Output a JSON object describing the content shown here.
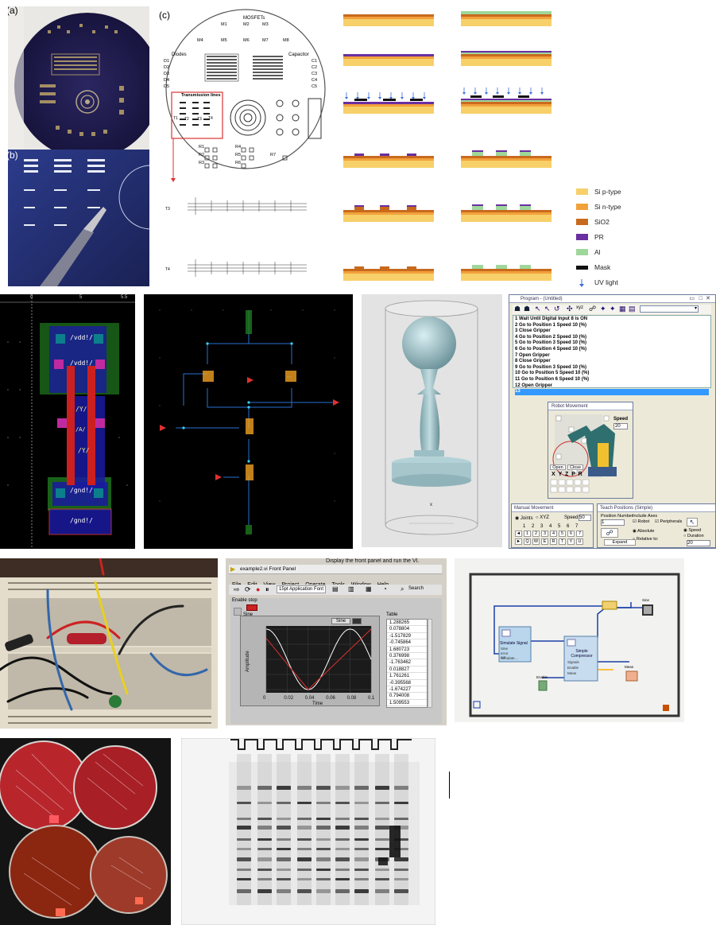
{
  "panels": {
    "a": {
      "label": "(a)"
    },
    "b": {
      "label": "(b)"
    },
    "c": {
      "label": "(c)",
      "mosfets_title": "MOSFETs",
      "mosfets": [
        "M1",
        "M2",
        "M3",
        "M4",
        "M5",
        "M6",
        "M7",
        "M8"
      ],
      "diodes_title": "Diodes",
      "diodes": [
        "D1",
        "D2",
        "D3",
        "D4",
        "D5"
      ],
      "capacitor_title": "Capacitor",
      "capacitors": [
        "C1",
        "C2",
        "C3",
        "C4",
        "C5"
      ],
      "tlines_title": "Transmission lines",
      "tlines": [
        "T1",
        "T2",
        "T3",
        "T4"
      ],
      "resistors": [
        "R1",
        "R2",
        "R3",
        "R4",
        "R5",
        "R6",
        "R7"
      ],
      "t3_label": "T3",
      "t4_label": "T4",
      "legend": [
        {
          "label": "Si p-type",
          "color": "#f7d06a"
        },
        {
          "label": "Si n-type",
          "color": "#f2a13a"
        },
        {
          "label": "SiO2",
          "color": "#c86a1e"
        },
        {
          "label": "PR",
          "color": "#6a2fa0"
        },
        {
          "label": "Al",
          "color": "#9fd79a"
        },
        {
          "label": "Mask",
          "color": "#111111"
        },
        {
          "label": "UV light",
          "color": "#3a6fd8"
        }
      ]
    },
    "layout": {
      "labels": [
        "/vdd!/",
        "/vdd!/",
        "/Y/",
        "/Y/",
        "/A/",
        "/gnd!/",
        "/gnd!/"
      ],
      "ruler": [
        "0",
        "5",
        "5.5"
      ]
    },
    "program": {
      "title": "Program - (Untitled)",
      "lines": [
        "1  Wait Until Digital Input 8 is ON",
        "2  Go to Position 1 Speed 10 (%)",
        "3  Close Gripper",
        "4  Go to Position 2 Speed 10 (%)",
        "5  Go to Position 3 Speed 10 (%)",
        "6  Go to Position 4 Speed 10 (%)",
        "7  Open Gripper",
        "8  Close Gripper",
        "9  Go to Position 3 Speed 10 (%)",
        "10  Go to Position 5 Speed 10 (%)",
        "11  Go to Position 6 Speed 10 (%)",
        "12  Open Gripper",
        "13"
      ],
      "robot_title": "Robot Movement",
      "speed_label": "Speed",
      "speed_value": "20",
      "open_label": "Open",
      "close_label": "Close",
      "axes": "X Y Z P R",
      "manual_title": "Manual Movement",
      "joints_label": "Joints",
      "xyz_label": "XYZ",
      "manual_speed_label": "Speed:",
      "manual_speed_value": "50",
      "joint_numbers": [
        "1",
        "2",
        "3",
        "4",
        "5",
        "6",
        "7"
      ],
      "keys": [
        "Q",
        "W",
        "E",
        "R",
        "T",
        "Y",
        "U"
      ],
      "teach_title": "Teach Positions (Simple)",
      "position_number_label": "Position Number",
      "position_number_value": "1",
      "include_axes_label": "Include Axes",
      "robot_label": "Robot",
      "peripherals_label": "Peripherals",
      "absolute_label": "Absolute",
      "relative_label": "Relative to:",
      "expand_label": "Expand",
      "speed_opt": "Speed",
      "duration_opt": "Duration",
      "teach_speed_value": "20"
    },
    "labview": {
      "caption": "Display the front panel and run the VI.",
      "title": "example2.vi Front Panel",
      "menu": [
        "File",
        "Edit",
        "View",
        "Project",
        "Operate",
        "Tools",
        "Window",
        "Help"
      ],
      "font_select": "15pt Application Font",
      "search": "Search",
      "enable_stop": "Enable stop",
      "sine_label": "Sine",
      "sine_plot_label": "Sine",
      "ylabel": "Amplitude",
      "xlabel": "Time",
      "table_title": "Table",
      "table_values": [
        "1.288265",
        "0.078804",
        "-1.517829",
        "-0.745864",
        "1.680723",
        "0.376998",
        "-1.763462",
        "0.018827",
        "1.761261",
        "-0.395568",
        "-1.674227",
        "0.794008",
        "1.509553"
      ],
      "xticks": [
        "0",
        "0.02",
        "0.04",
        "0.06",
        "0.08",
        "0.1"
      ]
    },
    "blockdiagram": {
      "simulate_label": "Simulate Signal",
      "simulate_items": [
        "Sine",
        "error out",
        "Simulate..."
      ],
      "compress_label": "Simple Compressor",
      "compress_items": [
        "Signals",
        "Enable",
        "Mean"
      ],
      "enable_label": "Enable",
      "sine_label": "Sine",
      "mean_label": "Mean"
    }
  },
  "chart_data": {
    "type": "line",
    "title": "",
    "xlabel": "Time",
    "ylabel": "Amplitude",
    "xlim": [
      0,
      0.1
    ],
    "x_ticks": [
      0,
      0.02,
      0.04,
      0.06,
      0.08,
      0.1
    ],
    "series": [
      {
        "name": "Sine",
        "color": "#ffffff",
        "shape": "sine",
        "x": [
          0,
          0.02,
          0.04,
          0.06,
          0.08,
          0.1
        ],
        "values": [
          1,
          0.1,
          -1,
          0,
          1,
          0.2
        ]
      },
      {
        "color": "#d9302c",
        "shape": "triangle",
        "x": [
          0,
          0.04,
          0.1
        ],
        "values": [
          0.7,
          -1,
          1
        ]
      }
    ]
  }
}
